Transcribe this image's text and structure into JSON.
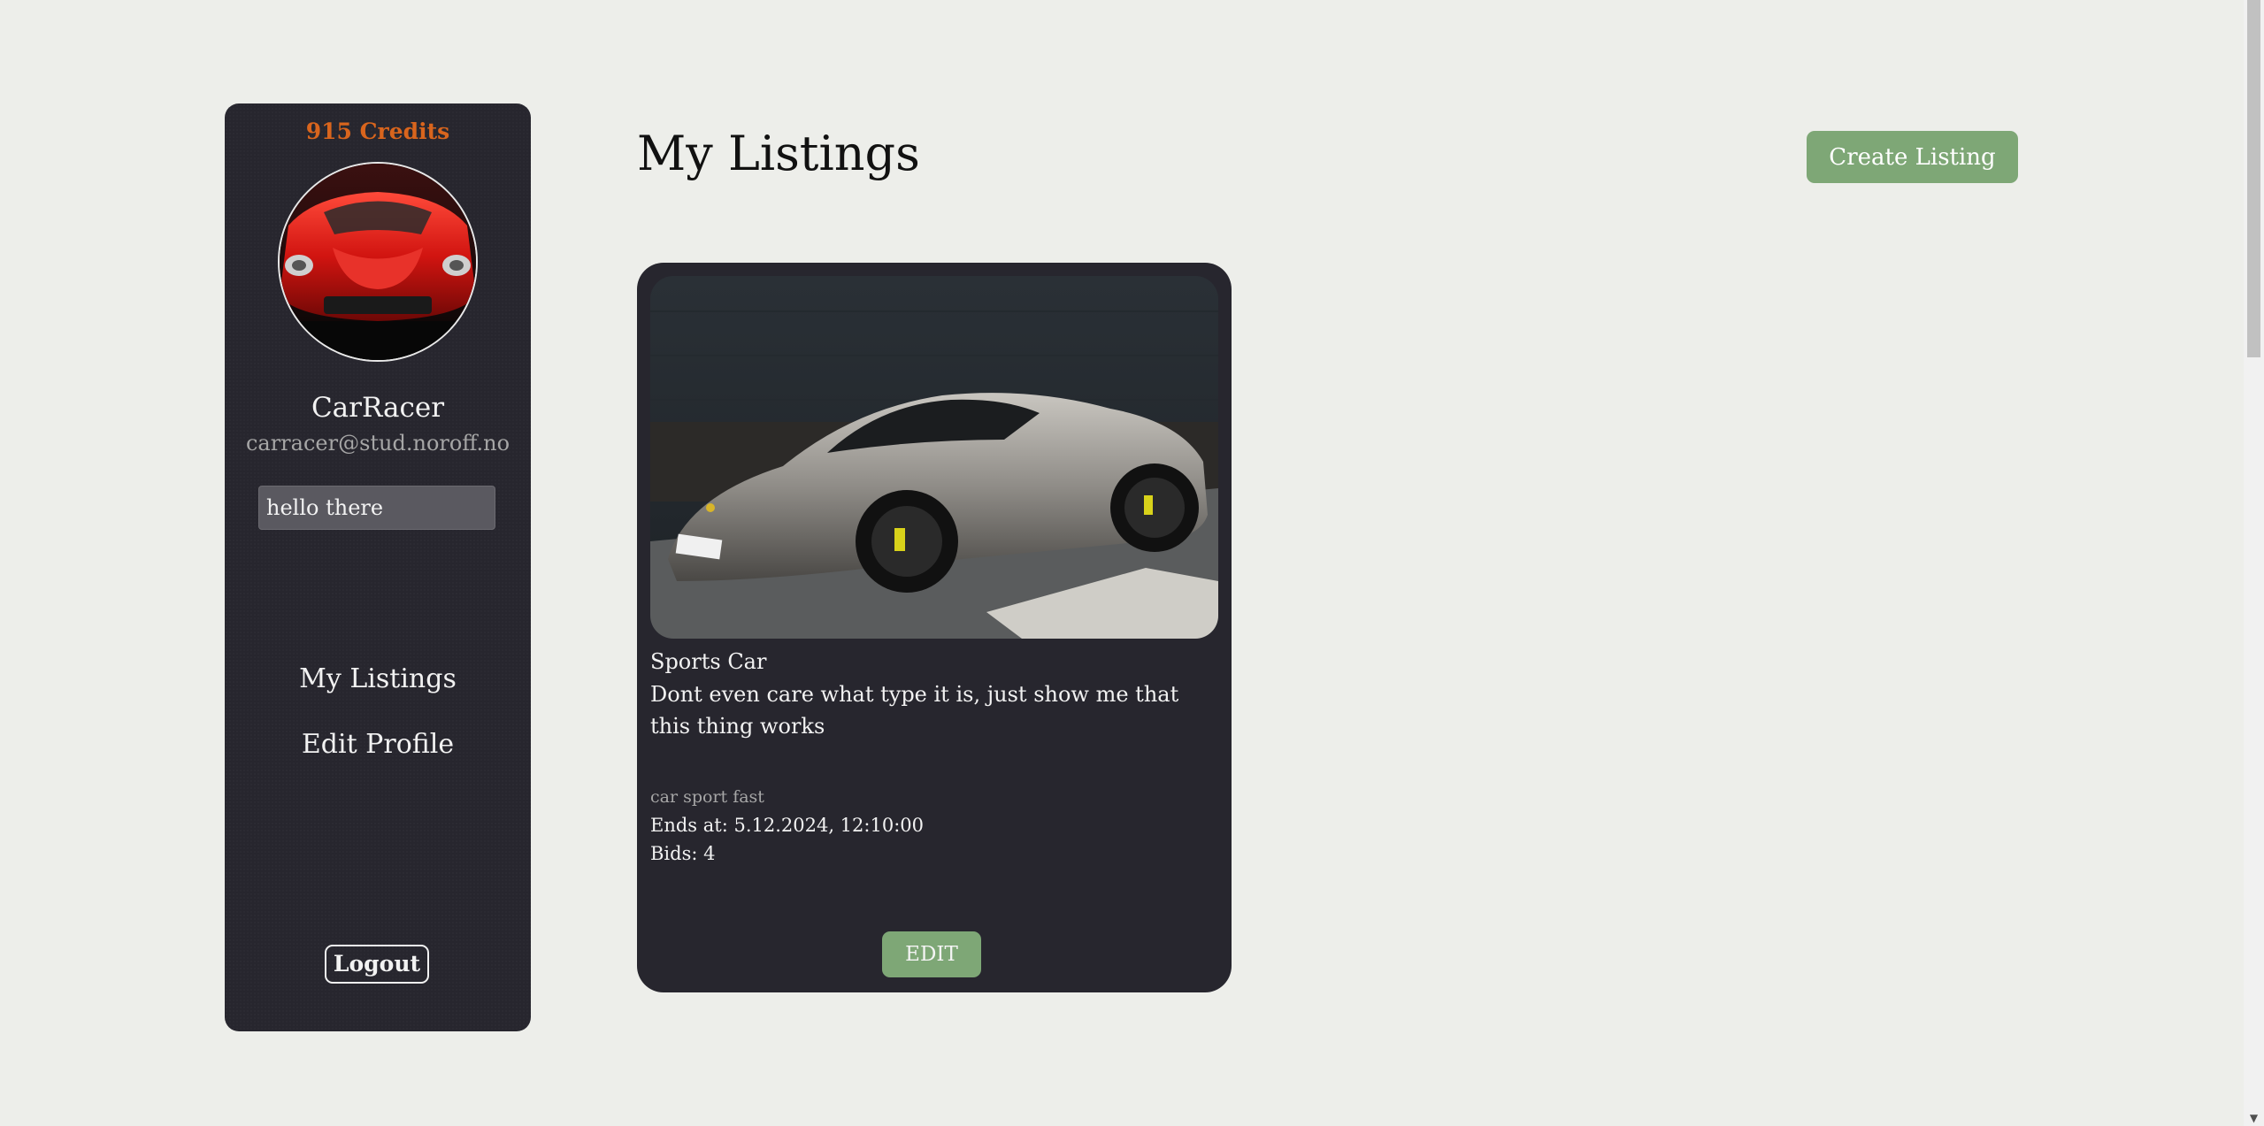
{
  "sidebar": {
    "credits": "915 Credits",
    "username": "CarRacer",
    "email": "carracer@stud.noroff.no",
    "bio": "hello there",
    "nav": [
      "My Listings",
      "Edit Profile"
    ],
    "logout_label": "Logout"
  },
  "main": {
    "title": "My Listings",
    "create_label": "Create Listing",
    "listings": [
      {
        "title": "Sports Car",
        "description": "Dont even care what type it is, just show me that this thing works",
        "tags": "car sport fast",
        "ends": "Ends at: 5.12.2024, 12:10:00",
        "bids": "Bids: 4",
        "edit_label": "EDIT"
      }
    ]
  },
  "colors": {
    "background": "#edeeea",
    "sidebar": "#27262e",
    "card": "#27262e",
    "accent_green": "#7ea776",
    "credits_orange": "#d9651d"
  },
  "icons": {
    "avatar_image": "red-sports-car-front",
    "listing_image": "silver-sports-car"
  }
}
